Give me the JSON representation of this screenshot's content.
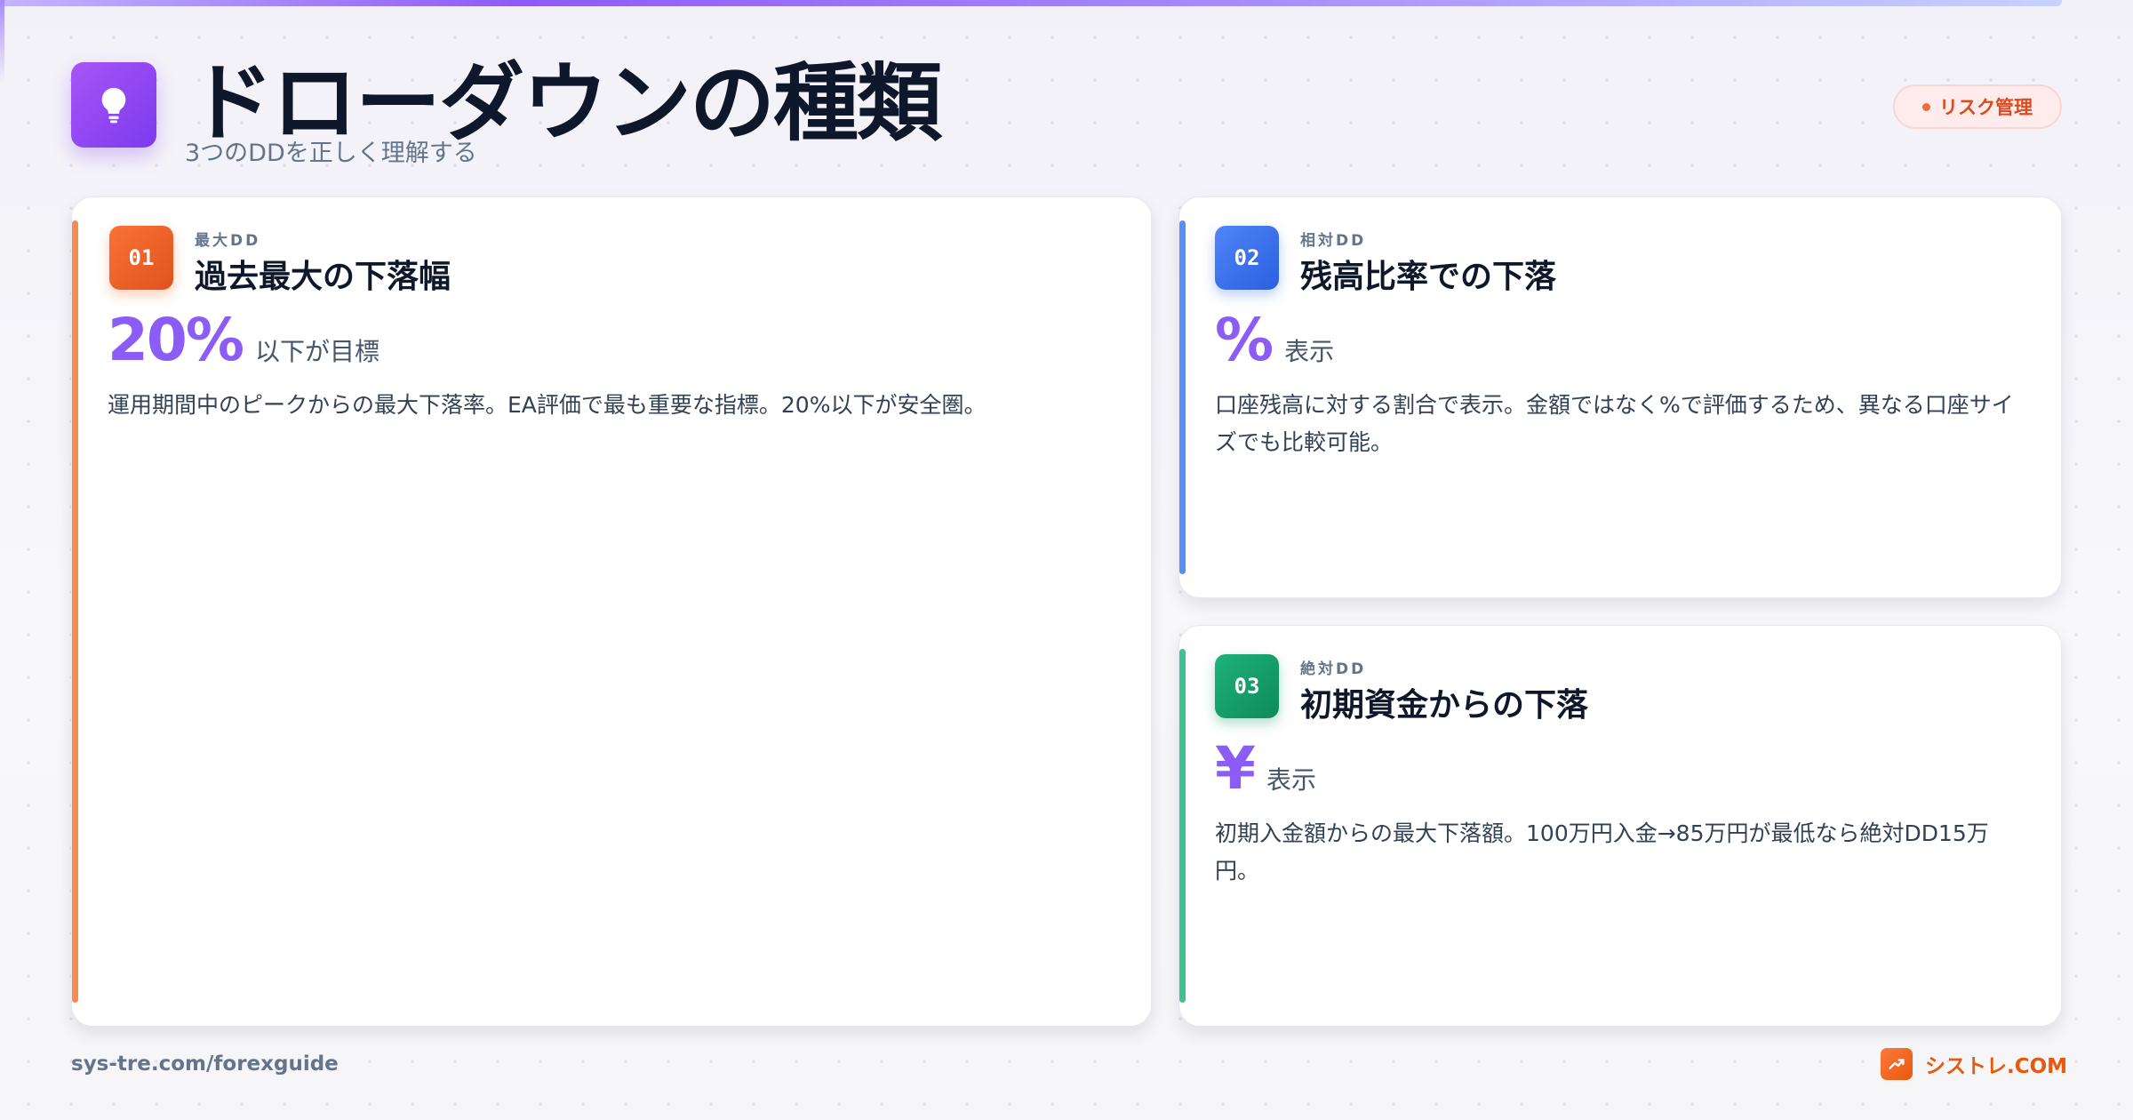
{
  "header": {
    "title": "ドローダウンの種類",
    "subtitle": "3つのDDを正しく理解する",
    "tag": "リスク管理",
    "icon": "lightbulb-icon"
  },
  "colors": {
    "accent": "#8b5cf6",
    "card1": "#f97335",
    "card2": "#3b74f0",
    "card3": "#14a06a",
    "brand": "#ea580c"
  },
  "cards": [
    {
      "number": "01",
      "kicker": "最大DD",
      "title": "過去最大の下落幅",
      "metric_value": "20%",
      "metric_unit": "以下が目標",
      "description": "運用期間中のピークからの最大下落率。EA評価で最も重要な指標。20%以下が安全圏。"
    },
    {
      "number": "02",
      "kicker": "相対DD",
      "title": "残高比率での下落",
      "metric_value": "%",
      "metric_unit": "表示",
      "description": "口座残高に対する割合で表示。金額ではなく%で評価するため、異なる口座サイズでも比較可能。"
    },
    {
      "number": "03",
      "kicker": "絶対DD",
      "title": "初期資金からの下落",
      "metric_value": "¥",
      "metric_unit": "表示",
      "description": "初期入金額からの最大下落額。100万円入金→85万円が最低なら絶対DD15万円。"
    }
  ],
  "footer": {
    "url": "sys-tre.com/forexguide",
    "brand": "シストレ.COM",
    "brand_icon": "trend-up-icon"
  }
}
